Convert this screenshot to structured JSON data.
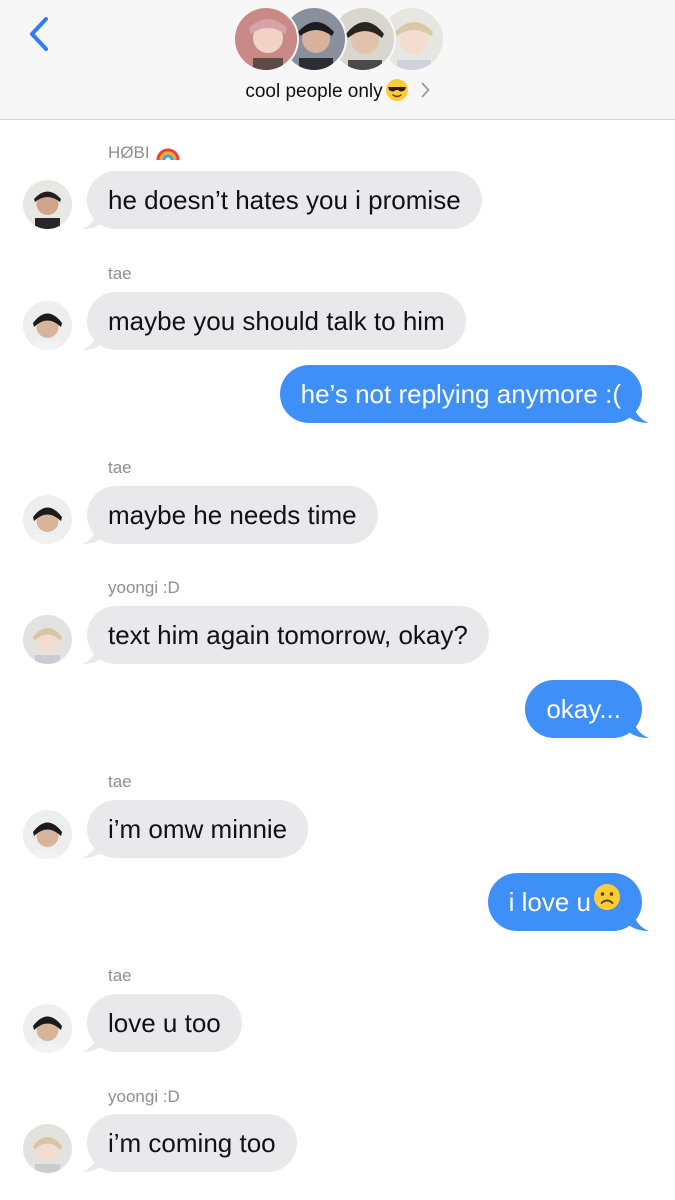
{
  "header": {
    "group_name": "cool people only",
    "group_emoji": "sunglasses-emoji",
    "back_icon": "chevron-left-icon",
    "accent": "#2f7cf6"
  },
  "colors": {
    "incoming_bubble": "#e9e9eb",
    "outgoing_bubble": "#3f8ff8"
  },
  "messages": [
    {
      "sender": "HØBI",
      "sender_emoji": "rainbow-emoji",
      "text": "he doesn’t hates you i promise",
      "direction": "incoming"
    },
    {
      "sender": "tae",
      "text": "maybe you should talk to him",
      "direction": "incoming"
    },
    {
      "text": "he’s not replying anymore :(",
      "direction": "outgoing"
    },
    {
      "sender": "tae",
      "text": "maybe he needs time",
      "direction": "incoming"
    },
    {
      "sender": "yoongi :D",
      "text": "text him again tomorrow, okay?",
      "direction": "incoming"
    },
    {
      "text": "okay...",
      "direction": "outgoing"
    },
    {
      "sender": "tae",
      "text": "i’m omw minnie",
      "direction": "incoming"
    },
    {
      "text": "i love u",
      "emoji": "frowning-face-emoji",
      "direction": "outgoing"
    },
    {
      "sender": "tae",
      "text": "love u too",
      "direction": "incoming"
    },
    {
      "sender": "yoongi :D",
      "text": "i’m coming too",
      "direction": "incoming"
    }
  ]
}
